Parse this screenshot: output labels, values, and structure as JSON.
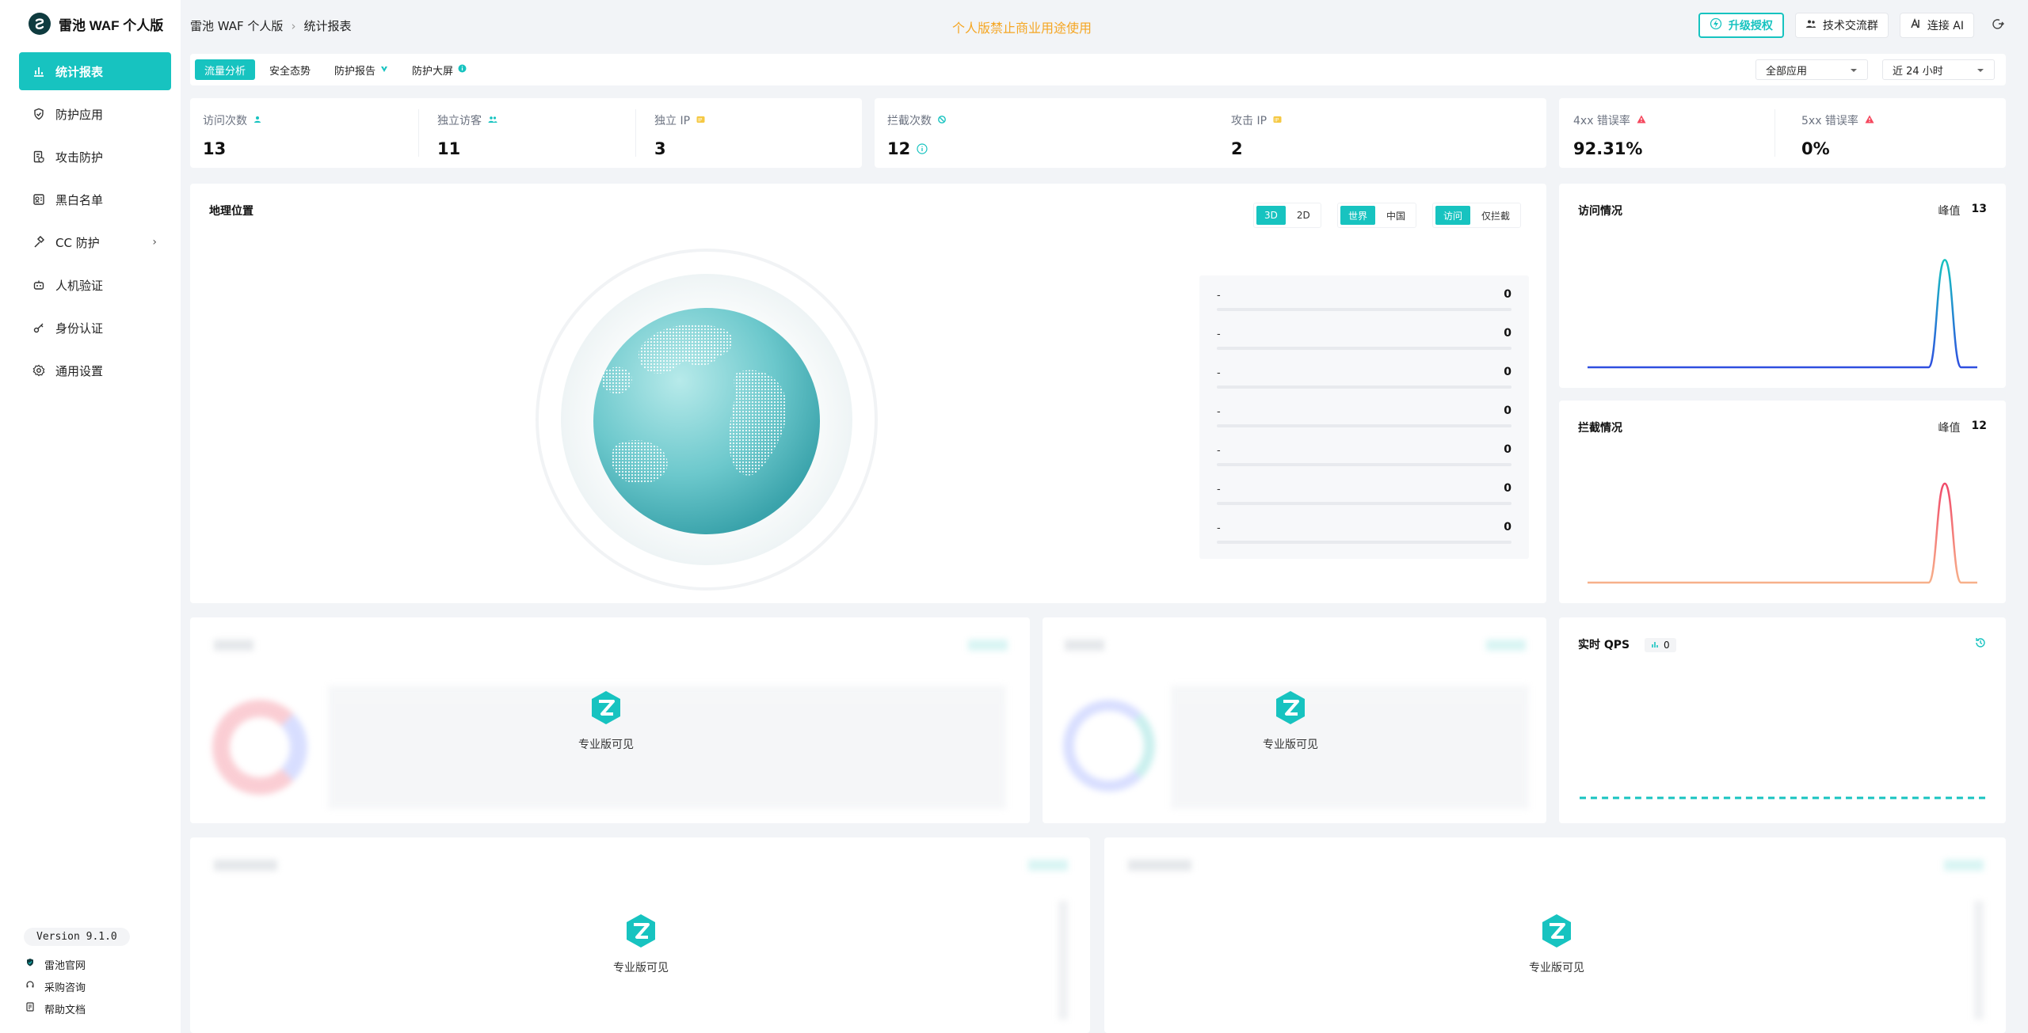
{
  "app": {
    "name": "雷池 WAF 个人版"
  },
  "sidebar": {
    "items": [
      {
        "label": "统计报表",
        "icon": "bar-chart-icon",
        "active": true
      },
      {
        "label": "防护应用",
        "icon": "shield-icon"
      },
      {
        "label": "攻击防护",
        "icon": "document-shield-icon"
      },
      {
        "label": "黑白名单",
        "icon": "list-icon"
      },
      {
        "label": "CC 防护",
        "icon": "hammer-icon",
        "expandable": true
      },
      {
        "label": "人机验证",
        "icon": "robot-icon"
      },
      {
        "label": "身份认证",
        "icon": "key-icon"
      },
      {
        "label": "通用设置",
        "icon": "gear-icon"
      }
    ],
    "version": "Version 9.1.0",
    "footer_links": [
      {
        "label": "雷池官网",
        "icon": "shield-logo-icon"
      },
      {
        "label": "采购咨询",
        "icon": "headset-icon"
      },
      {
        "label": "帮助文档",
        "icon": "document-icon"
      }
    ]
  },
  "header": {
    "breadcrumb": [
      "雷池 WAF 个人版",
      "统计报表"
    ],
    "notice": "个人版禁止商业用途使用",
    "upgrade_label": "升级授权",
    "community_label": "技术交流群",
    "ai_label": "连接 AI"
  },
  "tabs": [
    {
      "label": "流量分析",
      "active": true
    },
    {
      "label": "安全态势"
    },
    {
      "label": "防护报告"
    },
    {
      "label": "防护大屏"
    }
  ],
  "filters": {
    "app_select": "全部应用",
    "time_select": "近 24 小时"
  },
  "stats": {
    "visits": {
      "label": "访问次数",
      "value": "13"
    },
    "unique_visitors": {
      "label": "独立访客",
      "value": "11"
    },
    "unique_ip": {
      "label": "独立 IP",
      "value": "3"
    },
    "blocked": {
      "label": "拦截次数",
      "value": "12"
    },
    "attack_ip": {
      "label": "攻击 IP",
      "value": "2"
    },
    "err4xx": {
      "label": "4xx 错误率",
      "value": "92.31%"
    },
    "err5xx": {
      "label": "5xx 错误率",
      "value": "0%"
    }
  },
  "geo": {
    "title": "地理位置",
    "dim_options": [
      "3D",
      "2D"
    ],
    "region_options": [
      "世界",
      "中国"
    ],
    "type_options": [
      "访问",
      "仅拦截"
    ],
    "ranking": [
      {
        "name": "-",
        "count": "0"
      },
      {
        "name": "-",
        "count": "0"
      },
      {
        "name": "-",
        "count": "0"
      },
      {
        "name": "-",
        "count": "0"
      },
      {
        "name": "-",
        "count": "0"
      },
      {
        "name": "-",
        "count": "0"
      },
      {
        "name": "-",
        "count": "0"
      }
    ]
  },
  "access": {
    "title": "访问情况",
    "peak_label": "峰值",
    "peak_value": "13"
  },
  "block": {
    "title": "拦截情况",
    "peak_label": "峰值",
    "peak_value": "12"
  },
  "qps": {
    "title": "实时 QPS",
    "value": "0"
  },
  "pro_label": "专业版可见",
  "colors": {
    "accent": "#17c3c0",
    "warning": "#f5a623",
    "access_line": "#2f6fe0",
    "block_line": "#f0707a"
  },
  "chart_data": [
    {
      "type": "line",
      "title": "访问情况",
      "x": [
        0,
        1,
        2,
        3,
        4,
        5,
        6,
        7,
        8,
        9,
        10,
        11,
        12,
        13,
        14,
        15,
        16,
        17,
        18,
        19,
        20,
        21,
        22,
        23,
        24
      ],
      "series": [
        {
          "values": [
            0,
            0,
            0,
            0,
            0,
            0,
            0,
            0,
            0,
            0,
            0,
            0,
            0,
            0,
            0,
            0,
            0,
            0,
            0,
            0,
            0,
            0,
            13,
            0,
            0
          ]
        }
      ],
      "ylim": [
        0,
        14
      ]
    },
    {
      "type": "line",
      "title": "拦截情况",
      "x": [
        0,
        1,
        2,
        3,
        4,
        5,
        6,
        7,
        8,
        9,
        10,
        11,
        12,
        13,
        14,
        15,
        16,
        17,
        18,
        19,
        20,
        21,
        22,
        23,
        24
      ],
      "series": [
        {
          "values": [
            0,
            0,
            0,
            0,
            0,
            0,
            0,
            0,
            0,
            0,
            0,
            0,
            0,
            0,
            0,
            0,
            0,
            0,
            0,
            0,
            0,
            0,
            12,
            0,
            0
          ]
        }
      ],
      "ylim": [
        0,
        14
      ]
    },
    {
      "type": "line",
      "title": "实时 QPS",
      "x": [
        0,
        1,
        2,
        3,
        4,
        5,
        6,
        7,
        8,
        9,
        10,
        11,
        12,
        13,
        14,
        15,
        16,
        17,
        18,
        19
      ],
      "series": [
        {
          "values": [
            0,
            0,
            0,
            0,
            0,
            0,
            0,
            0,
            0,
            0,
            0,
            0,
            0,
            0,
            0,
            0,
            0,
            0,
            0,
            0
          ]
        }
      ],
      "ylim": [
        0,
        1
      ]
    }
  ]
}
